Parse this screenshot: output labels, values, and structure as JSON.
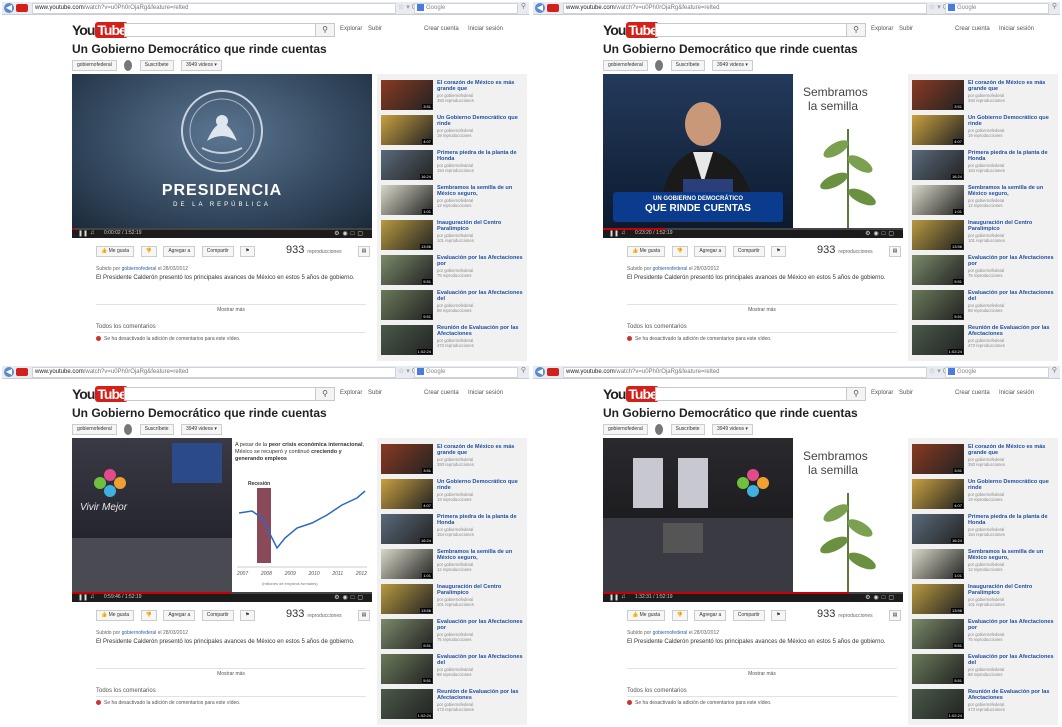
{
  "browser": {
    "url_domain": "www.youtube.com",
    "url_path": "/watch?v=u0Ph0rOjaRg&feature=relted",
    "search_engine": "Google"
  },
  "youtube": {
    "logo_you": "You",
    "logo_tube": "Tube",
    "explore": "Explorar",
    "upload": "Subir",
    "create_account": "Crear cuenta",
    "sign_in": "Iniciar sesión"
  },
  "video": {
    "title": "Un Gobierno Democrático que rinde cuentas",
    "channel": "gobiernofederal",
    "subscribe": "Suscríbete",
    "videos_count": "3949 videos",
    "like": "Me gusta",
    "add_to": "Agregar a",
    "share": "Compartir",
    "views": "933",
    "views_label": "reproducciones",
    "uploaded_prefix": "Subido por",
    "uploaded_suffix": "el 28/03/2012",
    "description": "El Presidente Calderón presentó los principales avances de México en estos 5 años de gobierno.",
    "show_more": "Mostrar más",
    "all_comments": "Todos los comentarios",
    "comments_disabled": "Se ha desactivado la adición de comentarios para este vídeo."
  },
  "overlays": {
    "presidencia": "PRESIDENCIA",
    "de_la_republica": "DE LA REPÚBLICA",
    "sembramos": "Sembramos",
    "la_semilla": "la semilla",
    "banner_line1": "UN GOBIERNO DEMOCRÁTICO",
    "banner_line2": "QUE RINDE CUENTAS",
    "crisis_text_1": "A pesar de la",
    "crisis_bold_1": "peor crisis económica internacional",
    "crisis_text_2": ", México se recuperó y continuó",
    "crisis_bold_2": "creciendo y generando empleos",
    "recesion": "Recesión",
    "chart_years": [
      "2007",
      "2008",
      "2009",
      "2010",
      "2011",
      "2012"
    ],
    "chart_note": "(millones de empleos formales)",
    "vivir_mejor": "Vivir Mejor"
  },
  "frames": [
    {
      "time": "0:00:02 / 1:52:19",
      "progress": 0.01
    },
    {
      "time": "0:23:20 / 1:52:19",
      "progress": 0.21
    },
    {
      "time": "0:59:46 / 1:52:19",
      "progress": 0.53
    },
    {
      "time": "1:32:31 / 1:52:19",
      "progress": 0.82
    }
  ],
  "related": [
    {
      "title": "El corazón de México es más grande que",
      "by": "por gobiernofederal",
      "views": "393 reproducciones",
      "duration": "3:51",
      "color": "#8a3a22"
    },
    {
      "title": "Un Gobierno Democrático que rinde",
      "by": "por gobiernofederal",
      "views": "19 reproducciones",
      "duration": "4:07",
      "color": "#c9a040"
    },
    {
      "title": "Primera piedra de la planta de Honda",
      "by": "por gobiernofederal",
      "views": "154 reproducciones",
      "duration": "16:24",
      "color": "#5a6a7a"
    },
    {
      "title": "Sembramos la semilla de un México seguro,",
      "by": "por gobiernofederal",
      "views": "12 reproducciones",
      "duration": "1:01",
      "color": "#d8d8c8"
    },
    {
      "title": "Inauguración del Centro Paralímpico",
      "by": "por gobiernofederal",
      "views": "101 reproducciones",
      "duration": "13:56",
      "color": "#b89a40"
    },
    {
      "title": "Evaluación por las Afectaciones por",
      "by": "por gobiernofederal",
      "views": "75 reproducciones",
      "duration": "5:51",
      "color": "#7a8a6a"
    },
    {
      "title": "Evaluación por las Afectaciones del",
      "by": "por gobiernofederal",
      "views": "88 reproducciones",
      "duration": "5:51",
      "color": "#6a7a5a"
    },
    {
      "title": "Reunión de Evaluación por las Afectaciones",
      "by": "por gobiernofederal",
      "views": "473 reproducciones",
      "duration": "1:02:24",
      "color": "#4a5a4a"
    }
  ],
  "colors": {
    "accent": "#d2201a",
    "link": "#1f4fa0"
  }
}
